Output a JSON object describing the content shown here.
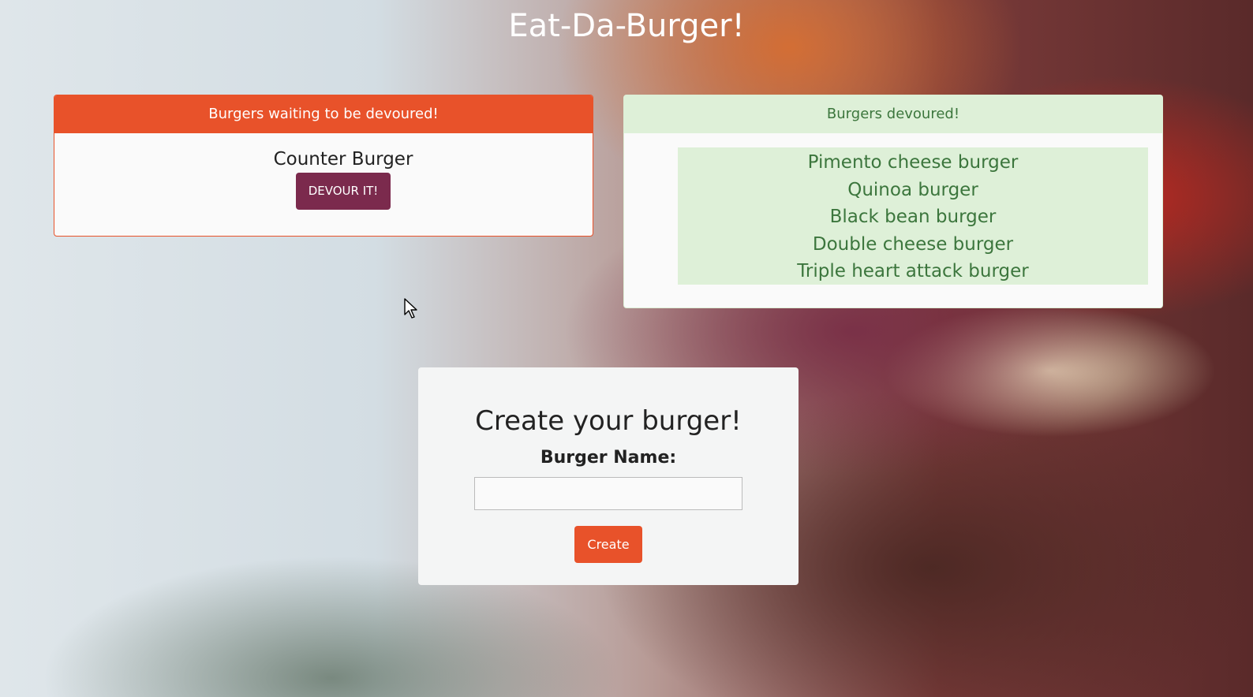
{
  "app": {
    "title": "Eat-Da-Burger!"
  },
  "waiting": {
    "header": "Burgers waiting to be devoured!",
    "items": [
      {
        "name": "Counter Burger",
        "button_label": "DEVOUR IT!"
      }
    ]
  },
  "devoured": {
    "header": "Burgers devoured!",
    "items": [
      "Pimento cheese burger",
      "Quinoa burger",
      "Black bean burger",
      "Double cheese burger",
      "Triple heart attack burger"
    ]
  },
  "create": {
    "title": "Create your burger!",
    "label": "Burger Name:",
    "input_value": "",
    "button_label": "Create"
  },
  "colors": {
    "accent": "#e8522a",
    "devour_button": "#7b2a4d",
    "success_bg": "#def0d8",
    "success_text": "#3c763d"
  }
}
